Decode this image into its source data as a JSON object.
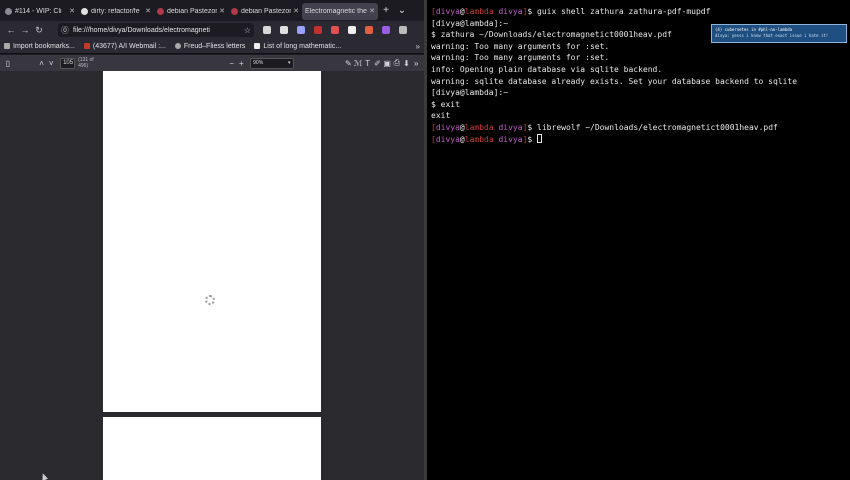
{
  "browser": {
    "tabs": [
      {
        "label": "#114 - WIP: Cli",
        "color": "#8a8a92"
      },
      {
        "label": "dirty: refactor/fe",
        "color": "#e0e0e0"
      },
      {
        "label": "debian Pastezone",
        "color": "#b03a4a"
      },
      {
        "label": "debian Pastezone",
        "color": "#b03a4a"
      },
      {
        "label": "Electromagnetic the",
        "color": "#6b6b75",
        "active": true
      }
    ],
    "new_tab": "+",
    "tab_list": "⌄",
    "nav": {
      "back": "←",
      "forward": "→",
      "reload": "↻"
    },
    "url": "file:///home/divya/Downloads/electromagneti",
    "url_prefix": "⓪",
    "bookmark_star": "☆",
    "extension_colors": [
      "#d8d8d8",
      "#e0e0e0",
      "#9aa0ff",
      "#c03030",
      "#e05050",
      "#f0f0f0",
      "#e06040",
      "#9b5de5",
      "#bbbbbb"
    ],
    "bookmarks": [
      {
        "label": "Import bookmarks..."
      },
      {
        "label": "(43677) A/I Webmail :..."
      },
      {
        "label": "Freud–Fliess letters"
      },
      {
        "label": "List of long mathematic..."
      }
    ],
    "bookmarks_more": "»",
    "pdf": {
      "sidebar_icon": "▯",
      "prev": "˄",
      "next": "˅",
      "page_number": "105",
      "page_of": "(131 of 496)",
      "zoom_out": "−",
      "zoom_in": "+",
      "zoom_value": "90%",
      "tools": [
        "✎",
        "ℳ",
        "T",
        "✐",
        "▣",
        "⎙",
        "⬇",
        "»"
      ]
    }
  },
  "terminal": {
    "user": "divya",
    "host": "lambda",
    "dir": "divya",
    "lines": [
      {
        "prompt": true,
        "cmd": "guix shell zathura zathura-pdf-mupdf"
      },
      {
        "text": "[divya@lambda]:~"
      },
      {
        "text": "$ zathura ~/Downloads/electromagnetict0001heav.pdf"
      },
      {
        "text": "warning: Too many arguments for :set."
      },
      {
        "text": "warning: Too many arguments for :set."
      },
      {
        "text": "info: Opening plain database via sqlite backend."
      },
      {
        "text": "warning: sqlite database already exists. Set your database backend to sqlite"
      },
      {
        "text": "[divya@lambda]:~"
      },
      {
        "text": "$ exit"
      },
      {
        "text": "exit"
      },
      {
        "prompt": true,
        "cmd": "librewolf ~/Downloads/electromagnetict0001heav.pdf"
      },
      {
        "prompt": true,
        "cmd": "",
        "cursor": true
      }
    ]
  },
  "notification": {
    "title": "(4) cubernetes in #phl-no-lambda",
    "body": "divya: yesss i know that exact issue i hate it!"
  }
}
